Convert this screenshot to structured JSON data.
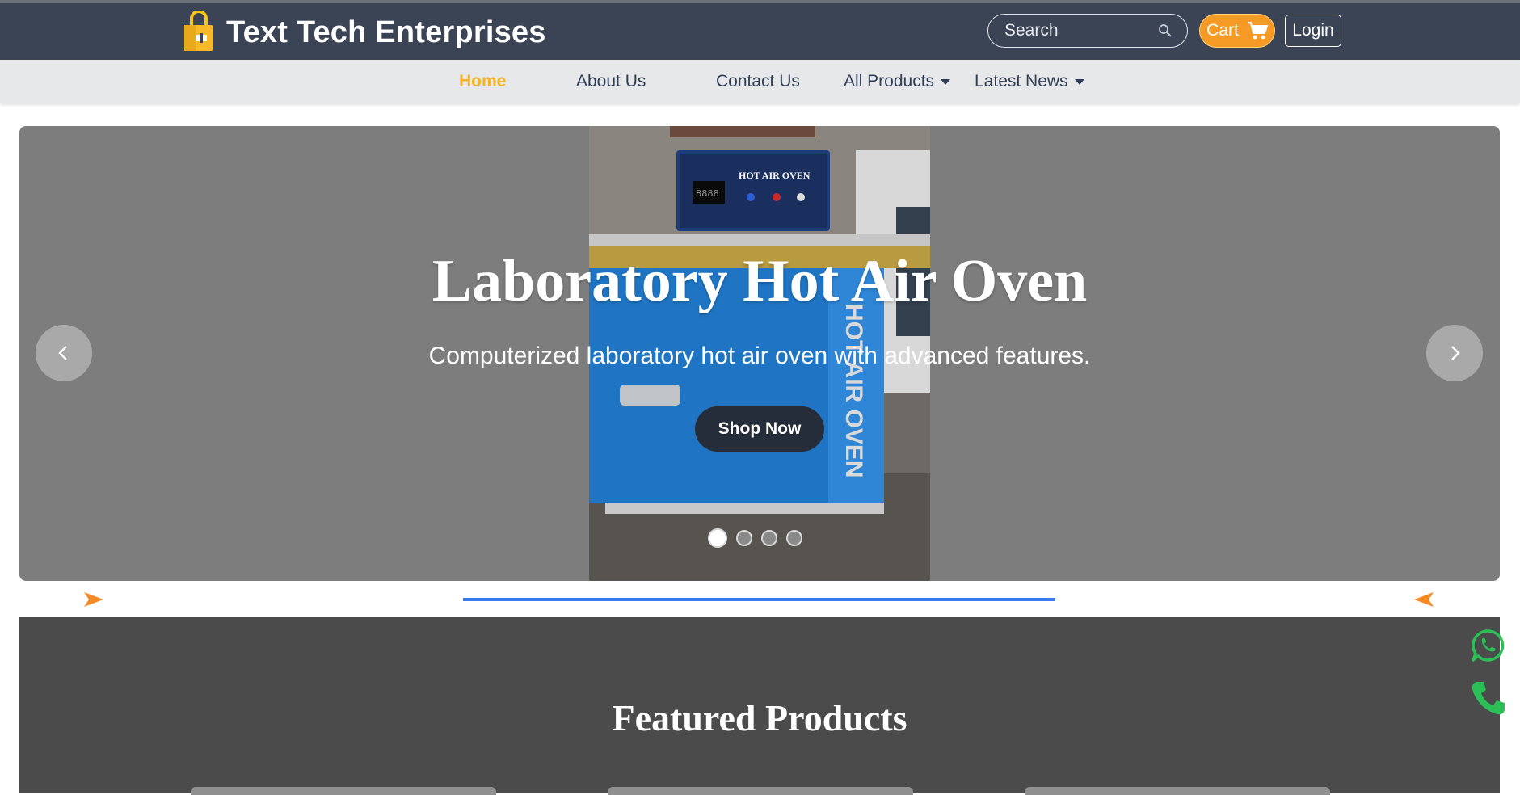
{
  "header": {
    "brand_title": "Text Tech Enterprises",
    "brand_icon": "shopping-bag-icon",
    "search_placeholder": "Search",
    "cart_label": "Cart",
    "login_label": "Login",
    "colors": {
      "header_bg": "#3b4455",
      "cart": "#f59a24",
      "accent": "#f5b424"
    }
  },
  "nav": {
    "items": [
      {
        "label": "Home",
        "active": true
      },
      {
        "label": "About Us"
      },
      {
        "label": "Contact Us"
      },
      {
        "label": "All Products",
        "dropdown": true
      },
      {
        "label": "Latest News",
        "dropdown": true
      }
    ]
  },
  "hero": {
    "heading": "Laboratory Hot Air Oven",
    "subheading": "Computerized laboratory hot air oven with advanced features.",
    "cta_label": "Shop Now",
    "slide_count": 4,
    "active_slide": 1,
    "photo_labels": {
      "panel": "HOT AIR OVEN",
      "door": "HOT AIR OVEN",
      "display": "8888"
    }
  },
  "featured": {
    "title": "Featured Products"
  },
  "floating": {
    "whatsapp_icon": "whatsapp-icon",
    "phone_icon": "phone-icon",
    "color": "#2bbf55"
  }
}
